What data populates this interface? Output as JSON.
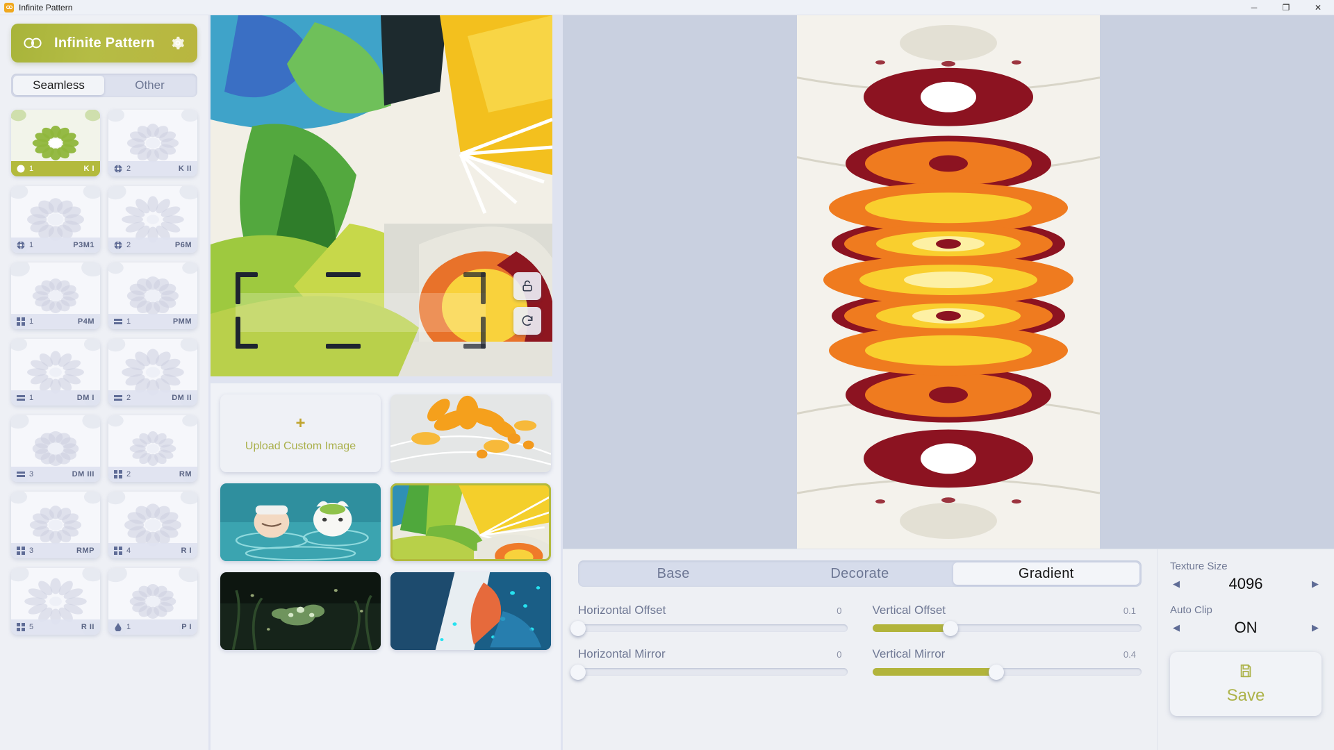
{
  "window": {
    "title": "Infinite Pattern",
    "app_icon": "infinity-icon",
    "minimize": "─",
    "maximize": "❐",
    "close": "✕"
  },
  "sidebar": {
    "brand_title": "Infinite Pattern",
    "brand_logo_icon": "infinity-icon",
    "settings_icon": "gear-icon",
    "tabs": [
      {
        "label": "Seamless",
        "active": true
      },
      {
        "label": "Other",
        "active": false
      }
    ],
    "patterns": [
      {
        "num": "1",
        "code": "K I",
        "sym": "rosette-icon",
        "selected": true
      },
      {
        "num": "2",
        "code": "K II",
        "sym": "rosette-icon",
        "selected": false
      },
      {
        "num": "1",
        "code": "P3M1",
        "sym": "rosette-icon",
        "selected": false
      },
      {
        "num": "2",
        "code": "P6M",
        "sym": "rosette-icon",
        "selected": false
      },
      {
        "num": "1",
        "code": "P4M",
        "sym": "grid-icon",
        "selected": false
      },
      {
        "num": "1",
        "code": "PMM",
        "sym": "bars-icon",
        "selected": false
      },
      {
        "num": "1",
        "code": "DM I",
        "sym": "bars-icon",
        "selected": false
      },
      {
        "num": "2",
        "code": "DM II",
        "sym": "bars-icon",
        "selected": false
      },
      {
        "num": "3",
        "code": "DM III",
        "sym": "bars-icon",
        "selected": false
      },
      {
        "num": "2",
        "code": "RM",
        "sym": "grid-icon",
        "selected": false
      },
      {
        "num": "3",
        "code": "RMP",
        "sym": "grid-icon",
        "selected": false
      },
      {
        "num": "4",
        "code": "R I",
        "sym": "grid-icon",
        "selected": false
      },
      {
        "num": "5",
        "code": "R II",
        "sym": "grid-icon",
        "selected": false
      },
      {
        "num": "1",
        "code": "P I",
        "sym": "drop-icon",
        "selected": false
      }
    ]
  },
  "source": {
    "lock_icon": "unlock-icon",
    "refresh_icon": "refresh-icon",
    "crop_handle_icon": "crop-corner-icon"
  },
  "tray": {
    "upload_plus": "+",
    "upload_label": "Upload Custom Image",
    "items": [
      {
        "name": "orange-flowers-thumbnail",
        "selected": false
      },
      {
        "name": "onsen-characters-thumbnail",
        "selected": false
      },
      {
        "name": "green-yellow-leaf-thumbnail",
        "selected": true
      },
      {
        "name": "dark-forest-thumbnail",
        "selected": false
      },
      {
        "name": "blue-figure-thumbnail",
        "selected": false
      }
    ]
  },
  "controls": {
    "tabs": [
      {
        "label": "Base",
        "active": false
      },
      {
        "label": "Decorate",
        "active": false
      },
      {
        "label": "Gradient",
        "active": true
      }
    ],
    "sliders": [
      {
        "label": "Horizontal Offset",
        "value": "0",
        "pct": 0
      },
      {
        "label": "Vertical Offset",
        "value": "0.1",
        "pct": 29
      },
      {
        "label": "Horizontal Mirror",
        "value": "0",
        "pct": 0
      },
      {
        "label": "Vertical Mirror",
        "value": "0.4",
        "pct": 46
      }
    ],
    "texture_size": {
      "label": "Texture Size",
      "value": "4096",
      "prev_icon": "◀",
      "next_icon": "▶"
    },
    "auto_clip": {
      "label": "Auto Clip",
      "value": "ON",
      "prev_icon": "◀",
      "next_icon": "▶"
    },
    "save": {
      "label": "Save",
      "icon": "save-icon"
    }
  },
  "colors": {
    "accent": "#b3ba3d",
    "brand_start": "#a8b43a",
    "brand_end": "#b9b63f",
    "panel_bg": "#eef0f5",
    "canvas_bg": "#c9d0e0",
    "text_muted": "#6f7894"
  }
}
